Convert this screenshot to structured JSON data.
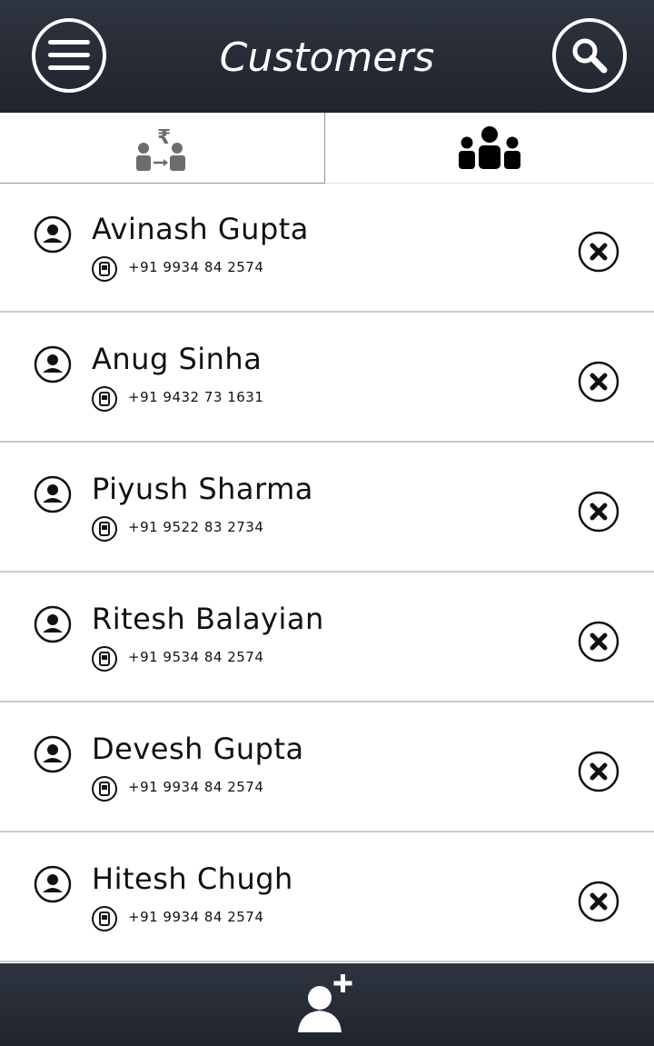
{
  "header": {
    "title": "Customers",
    "menu_icon": "hamburger-menu-icon",
    "search_icon": "search-icon",
    "background_color": "#262b34"
  },
  "tabs": [
    {
      "id": "transactions",
      "icon": "rupee-transfer-icon",
      "active": false
    },
    {
      "id": "customers",
      "icon": "group-people-icon",
      "active": true
    }
  ],
  "customers": [
    {
      "name": "Avinash Gupta",
      "phone": "+91 9934 84 2574"
    },
    {
      "name": "Anug Sinha",
      "phone": "+91 9432 73 1631"
    },
    {
      "name": "Piyush Sharma",
      "phone": "+91 9522 83 2734"
    },
    {
      "name": "Ritesh Balayian",
      "phone": "+91 9534 84 2574"
    },
    {
      "name": "Devesh Gupta",
      "phone": "+91 9934 84 2574"
    },
    {
      "name": "Hitesh Chugh",
      "phone": "+91 9934 84 2574"
    }
  ],
  "row_icons": {
    "person": "person-circle-icon",
    "phone": "mobile-phone-icon",
    "delete": "close-circle-icon"
  },
  "footer": {
    "add_icon": "add-user-icon"
  }
}
